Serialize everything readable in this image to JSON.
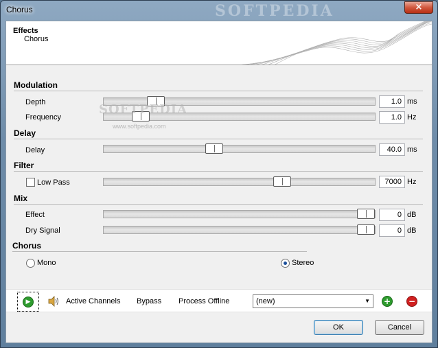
{
  "window": {
    "title": "Chorus",
    "close_glyph": "×",
    "watermark": "SOFTPEDIA"
  },
  "header": {
    "title": "Effects",
    "subtitle": "Chorus"
  },
  "sections": {
    "modulation": "Modulation",
    "delay": "Delay",
    "filter": "Filter",
    "mix": "Mix",
    "chorus": "Chorus"
  },
  "params": {
    "depth": {
      "label": "Depth",
      "value": "1.0",
      "unit": "ms",
      "position": 0.17
    },
    "frequency": {
      "label": "Frequency",
      "value": "1.0",
      "unit": "Hz",
      "position": 0.11
    },
    "delay": {
      "label": "Delay",
      "value": "40.0",
      "unit": "ms",
      "position": 0.4
    },
    "lowpass": {
      "label": "Low Pass",
      "checked": false,
      "value": "7000",
      "unit": "Hz",
      "position": 0.67
    },
    "effect": {
      "label": "Effect",
      "value": "0",
      "unit": "dB",
      "position": 1.0
    },
    "dry_signal": {
      "label": "Dry Signal",
      "value": "0",
      "unit": "dB",
      "position": 1.0
    }
  },
  "chorus_mode": {
    "mono": "Mono",
    "stereo": "Stereo",
    "selected": "stereo"
  },
  "watermark": {
    "mark": "SOFTPEDIA",
    "url": "www.softpedia.com"
  },
  "toolbar": {
    "play_icon": "play-icon",
    "speaker_icon": "speaker-icon",
    "active_channels": "Active Channels",
    "bypass": "Bypass",
    "process_offline": "Process Offline",
    "preset_value": "(new)",
    "add_icon": "add-icon",
    "remove_icon": "remove-icon"
  },
  "buttons": {
    "ok": "OK",
    "cancel": "Cancel"
  },
  "colors": {
    "accent_green": "#2e9b2e",
    "accent_red": "#d02020",
    "title_blue": "#6e8ca9"
  }
}
